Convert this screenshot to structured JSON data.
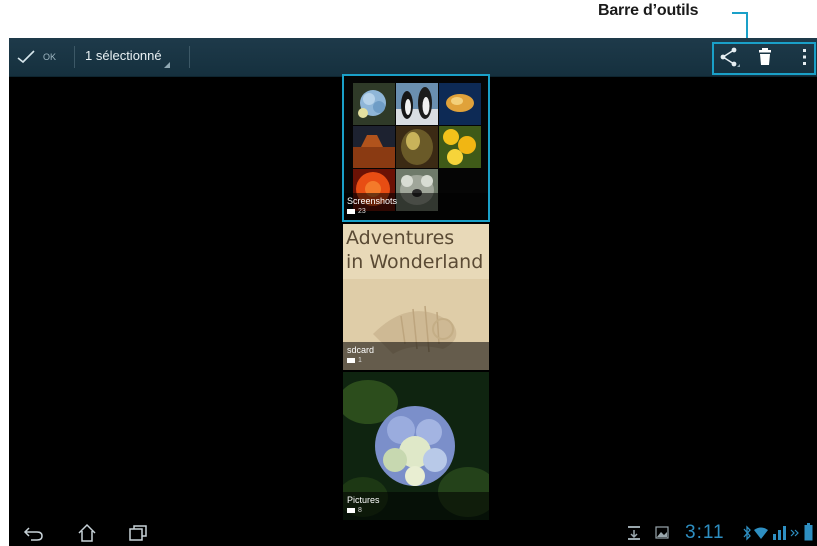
{
  "callout": {
    "label": "Barre d’outils"
  },
  "toolbar": {
    "done_label": "OK",
    "selection_label": "1 sélectionné",
    "icons": [
      "checkmark-icon",
      "share-icon",
      "trash-icon",
      "overflow-menu-icon"
    ]
  },
  "albums": [
    {
      "name": "Screenshots",
      "count": "23"
    },
    {
      "name": "sdcard",
      "count": "1",
      "image_text_line1": "Adventures",
      "image_text_line2": "in Wonderland"
    },
    {
      "name": "Pictures",
      "count": "8"
    }
  ],
  "status": {
    "time": "3:11"
  },
  "colors": {
    "accent": "#1aa0c8",
    "toolbar": "#1a3442",
    "clock": "#2e8fc2"
  }
}
